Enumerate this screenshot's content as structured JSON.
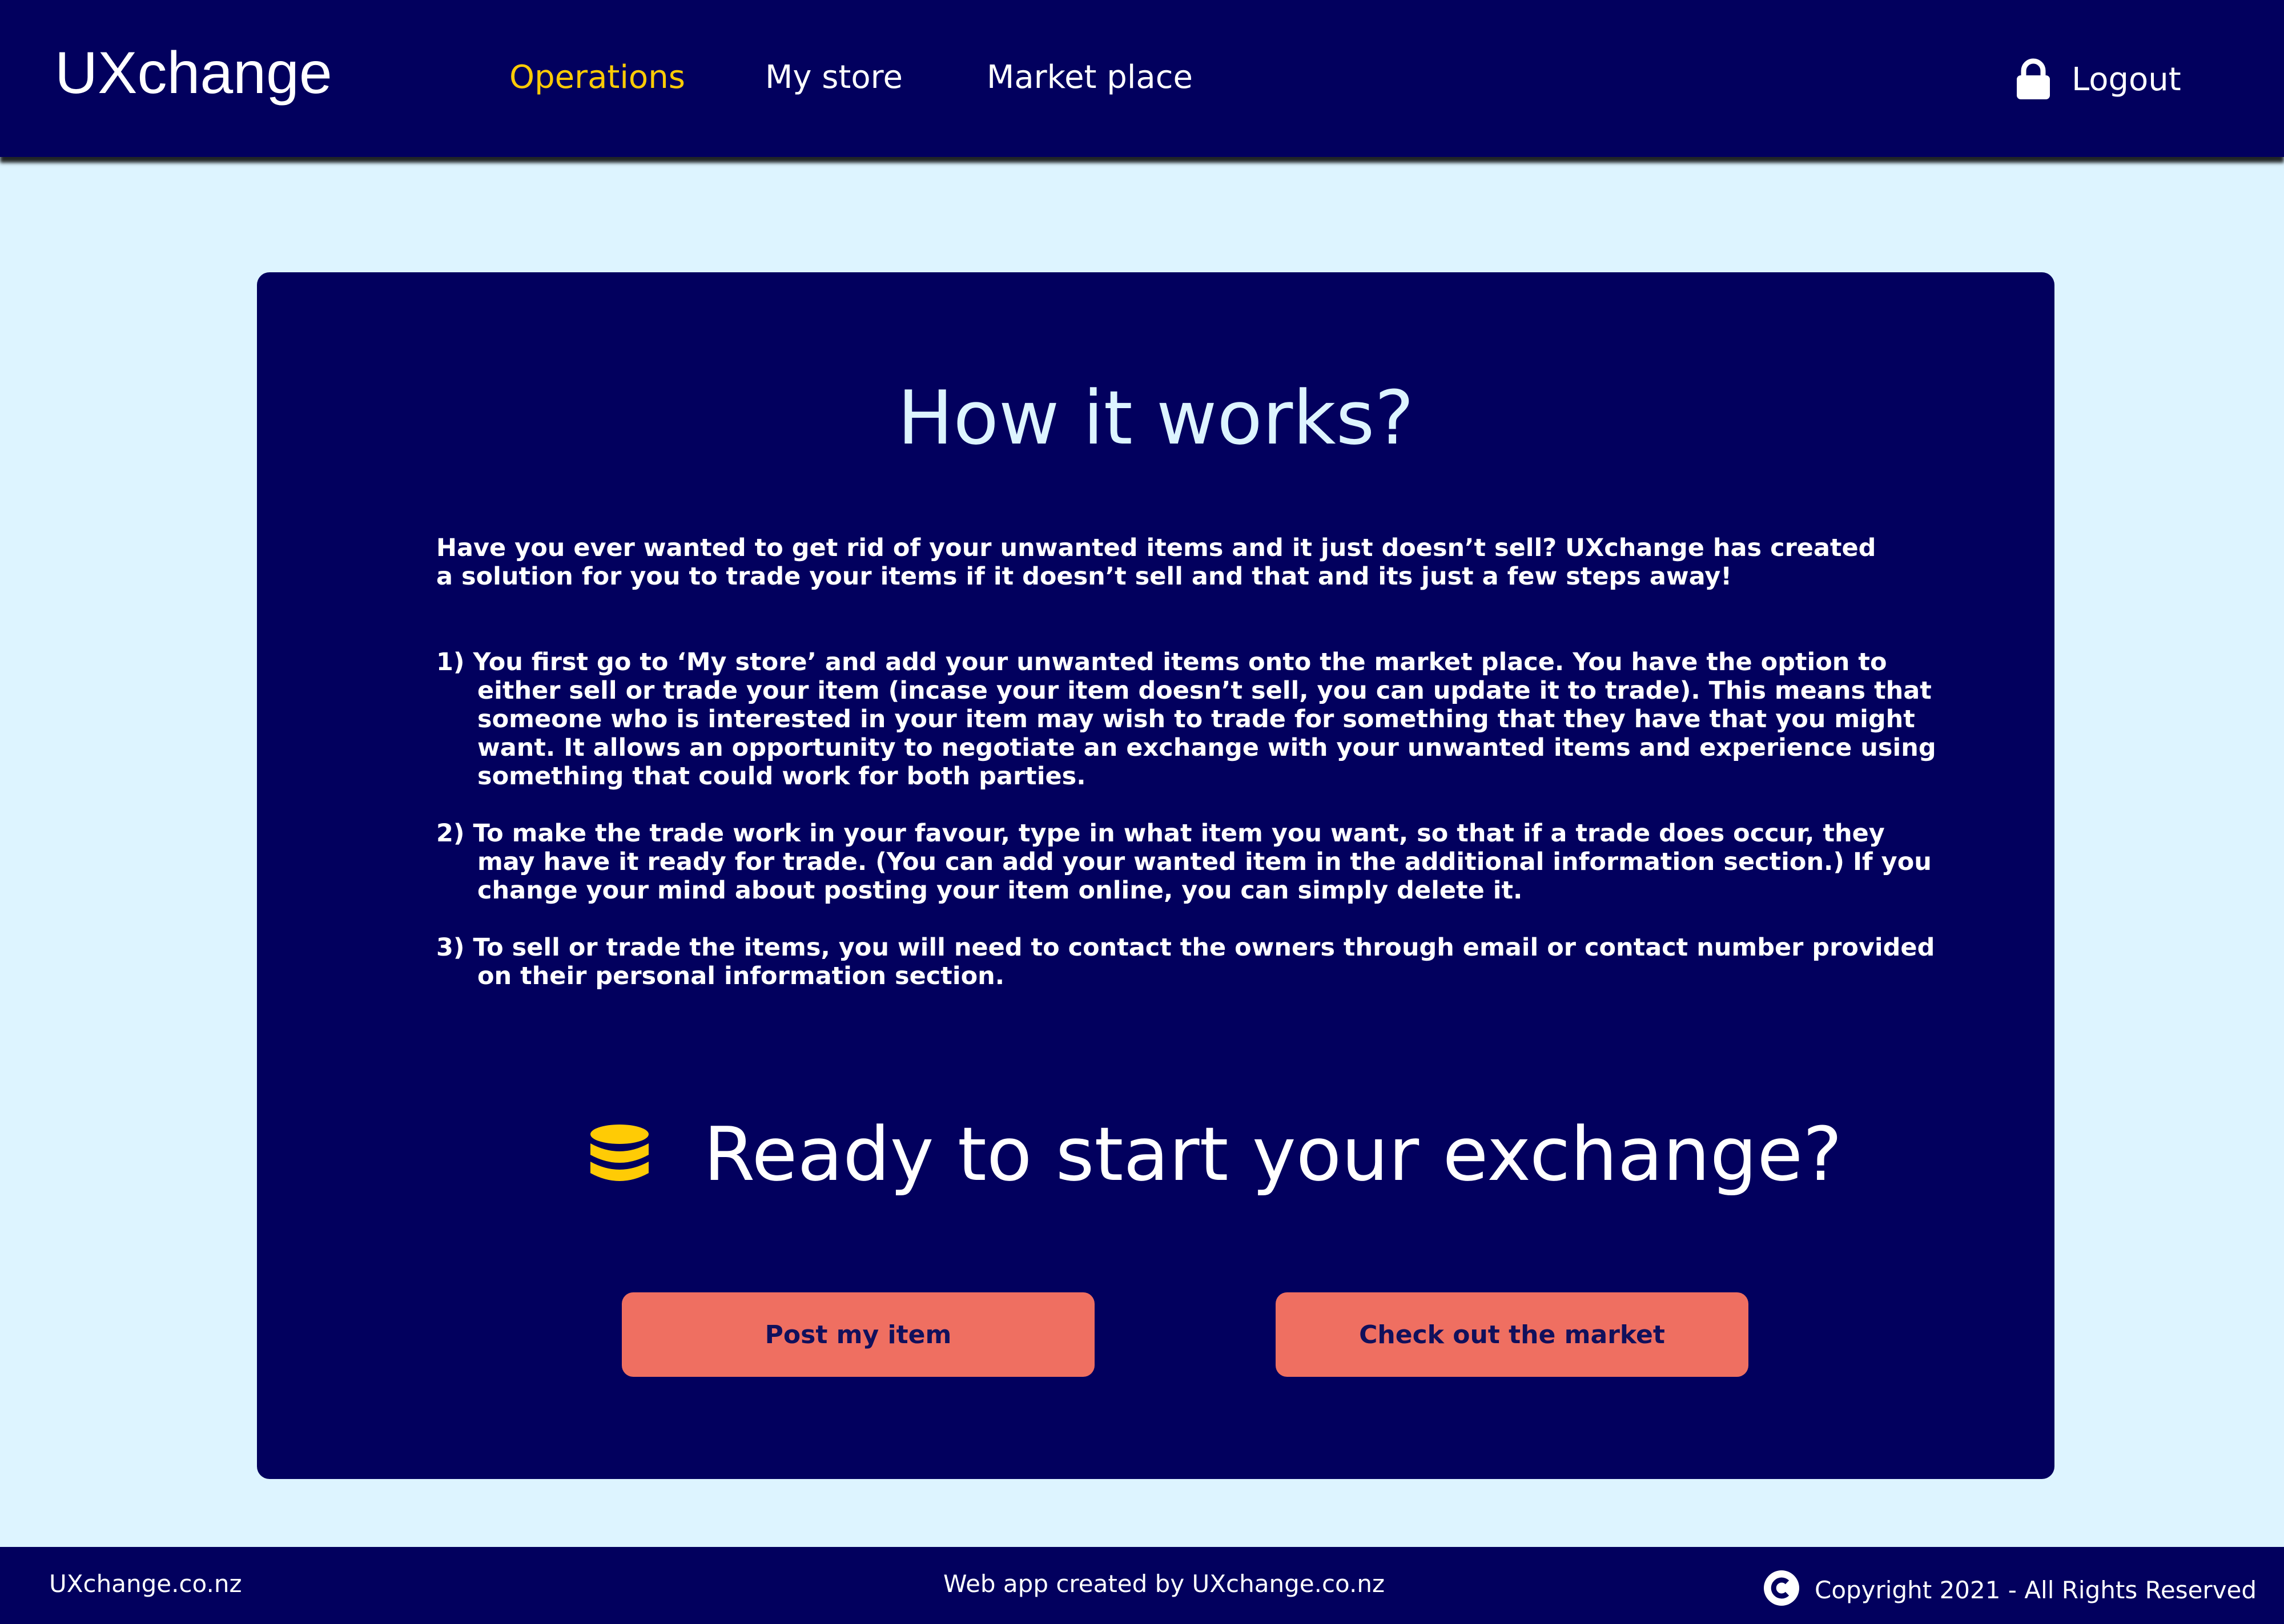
{
  "header": {
    "logo": "UXchange",
    "nav": [
      {
        "label": "Operations",
        "active": true
      },
      {
        "label": "My store",
        "active": false
      },
      {
        "label": "Market place",
        "active": false
      }
    ],
    "logout_label": "Logout",
    "logout_icon": "lock-icon"
  },
  "main": {
    "title": "How it works?",
    "intro": "Have you ever wanted to get rid of your unwanted items and it just doesn’t sell? UXchange has created a solution for you to trade your items if it doesn’t sell and that and its just a few steps away!",
    "steps": [
      "1) You first go to ‘My store’ and add your unwanted items onto the market place. You have the option to either sell or trade your item (incase your item doesn’t sell, you can update it to trade). This means that someone who is interested in your item may wish to trade for something that they have that you might want. It allows an opportunity to negotiate an exchange with your unwanted items and experience using something that could work for both parties.",
      "2) To make the trade work in your favour, type in what item you want, so that if a trade does occur, they may have it ready for trade. (You can add your wanted item in the additional information section.) If you change your mind about posting your item online, you can simply delete it.",
      "3) To sell or trade the items, you will need to contact the owners through email or contact number provided on their personal information section."
    ],
    "cta_text": "Ready to start your exchange?",
    "cta_icon": "coins-icon",
    "buttons": {
      "post": "Post my item",
      "market": "Check out the market"
    }
  },
  "footer": {
    "site": "UXchange.co.nz",
    "credit": "Web app created by UXchange.co.nz",
    "copyright": "Copyright 2021 - All Rights Reserved",
    "copyright_icon": "copyright-icon"
  },
  "colors": {
    "navy": "#02005e",
    "background": "#ddf4ff",
    "accent_yellow": "#ffcb05",
    "button_coral": "#ef6f61"
  }
}
